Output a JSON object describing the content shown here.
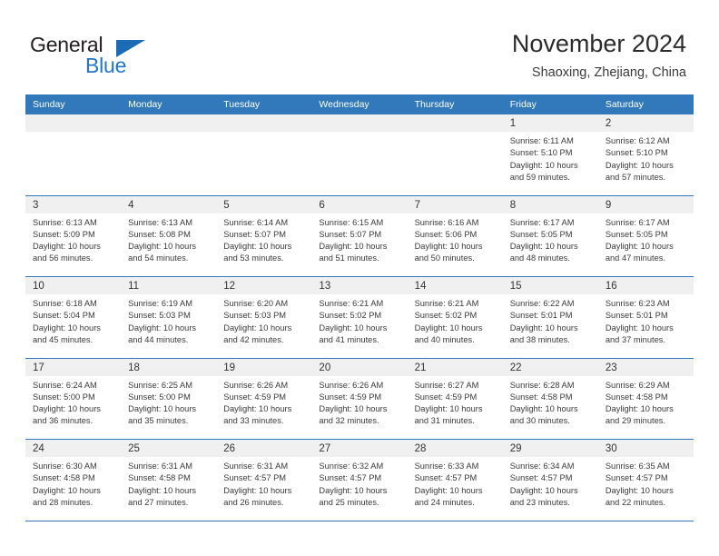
{
  "brand": {
    "name_dark": "General",
    "name_blue": "Blue",
    "accent_color": "#2176c7",
    "header_color": "#3179ba"
  },
  "header": {
    "title": "November 2024",
    "subtitle": "Shaoxing, Zhejiang, China"
  },
  "weekdays": [
    "Sunday",
    "Monday",
    "Tuesday",
    "Wednesday",
    "Thursday",
    "Friday",
    "Saturday"
  ],
  "weeks": [
    [
      {
        "empty": true,
        "day": "",
        "sunrise": "",
        "sunset": "",
        "daylight": ""
      },
      {
        "empty": true,
        "day": "",
        "sunrise": "",
        "sunset": "",
        "daylight": ""
      },
      {
        "empty": true,
        "day": "",
        "sunrise": "",
        "sunset": "",
        "daylight": ""
      },
      {
        "empty": true,
        "day": "",
        "sunrise": "",
        "sunset": "",
        "daylight": ""
      },
      {
        "empty": true,
        "day": "",
        "sunrise": "",
        "sunset": "",
        "daylight": ""
      },
      {
        "empty": false,
        "day": "1",
        "sunrise": "Sunrise: 6:11 AM",
        "sunset": "Sunset: 5:10 PM",
        "daylight": "Daylight: 10 hours and 59 minutes."
      },
      {
        "empty": false,
        "day": "2",
        "sunrise": "Sunrise: 6:12 AM",
        "sunset": "Sunset: 5:10 PM",
        "daylight": "Daylight: 10 hours and 57 minutes."
      }
    ],
    [
      {
        "empty": false,
        "day": "3",
        "sunrise": "Sunrise: 6:13 AM",
        "sunset": "Sunset: 5:09 PM",
        "daylight": "Daylight: 10 hours and 56 minutes."
      },
      {
        "empty": false,
        "day": "4",
        "sunrise": "Sunrise: 6:13 AM",
        "sunset": "Sunset: 5:08 PM",
        "daylight": "Daylight: 10 hours and 54 minutes."
      },
      {
        "empty": false,
        "day": "5",
        "sunrise": "Sunrise: 6:14 AM",
        "sunset": "Sunset: 5:07 PM",
        "daylight": "Daylight: 10 hours and 53 minutes."
      },
      {
        "empty": false,
        "day": "6",
        "sunrise": "Sunrise: 6:15 AM",
        "sunset": "Sunset: 5:07 PM",
        "daylight": "Daylight: 10 hours and 51 minutes."
      },
      {
        "empty": false,
        "day": "7",
        "sunrise": "Sunrise: 6:16 AM",
        "sunset": "Sunset: 5:06 PM",
        "daylight": "Daylight: 10 hours and 50 minutes."
      },
      {
        "empty": false,
        "day": "8",
        "sunrise": "Sunrise: 6:17 AM",
        "sunset": "Sunset: 5:05 PM",
        "daylight": "Daylight: 10 hours and 48 minutes."
      },
      {
        "empty": false,
        "day": "9",
        "sunrise": "Sunrise: 6:17 AM",
        "sunset": "Sunset: 5:05 PM",
        "daylight": "Daylight: 10 hours and 47 minutes."
      }
    ],
    [
      {
        "empty": false,
        "day": "10",
        "sunrise": "Sunrise: 6:18 AM",
        "sunset": "Sunset: 5:04 PM",
        "daylight": "Daylight: 10 hours and 45 minutes."
      },
      {
        "empty": false,
        "day": "11",
        "sunrise": "Sunrise: 6:19 AM",
        "sunset": "Sunset: 5:03 PM",
        "daylight": "Daylight: 10 hours and 44 minutes."
      },
      {
        "empty": false,
        "day": "12",
        "sunrise": "Sunrise: 6:20 AM",
        "sunset": "Sunset: 5:03 PM",
        "daylight": "Daylight: 10 hours and 42 minutes."
      },
      {
        "empty": false,
        "day": "13",
        "sunrise": "Sunrise: 6:21 AM",
        "sunset": "Sunset: 5:02 PM",
        "daylight": "Daylight: 10 hours and 41 minutes."
      },
      {
        "empty": false,
        "day": "14",
        "sunrise": "Sunrise: 6:21 AM",
        "sunset": "Sunset: 5:02 PM",
        "daylight": "Daylight: 10 hours and 40 minutes."
      },
      {
        "empty": false,
        "day": "15",
        "sunrise": "Sunrise: 6:22 AM",
        "sunset": "Sunset: 5:01 PM",
        "daylight": "Daylight: 10 hours and 38 minutes."
      },
      {
        "empty": false,
        "day": "16",
        "sunrise": "Sunrise: 6:23 AM",
        "sunset": "Sunset: 5:01 PM",
        "daylight": "Daylight: 10 hours and 37 minutes."
      }
    ],
    [
      {
        "empty": false,
        "day": "17",
        "sunrise": "Sunrise: 6:24 AM",
        "sunset": "Sunset: 5:00 PM",
        "daylight": "Daylight: 10 hours and 36 minutes."
      },
      {
        "empty": false,
        "day": "18",
        "sunrise": "Sunrise: 6:25 AM",
        "sunset": "Sunset: 5:00 PM",
        "daylight": "Daylight: 10 hours and 35 minutes."
      },
      {
        "empty": false,
        "day": "19",
        "sunrise": "Sunrise: 6:26 AM",
        "sunset": "Sunset: 4:59 PM",
        "daylight": "Daylight: 10 hours and 33 minutes."
      },
      {
        "empty": false,
        "day": "20",
        "sunrise": "Sunrise: 6:26 AM",
        "sunset": "Sunset: 4:59 PM",
        "daylight": "Daylight: 10 hours and 32 minutes."
      },
      {
        "empty": false,
        "day": "21",
        "sunrise": "Sunrise: 6:27 AM",
        "sunset": "Sunset: 4:59 PM",
        "daylight": "Daylight: 10 hours and 31 minutes."
      },
      {
        "empty": false,
        "day": "22",
        "sunrise": "Sunrise: 6:28 AM",
        "sunset": "Sunset: 4:58 PM",
        "daylight": "Daylight: 10 hours and 30 minutes."
      },
      {
        "empty": false,
        "day": "23",
        "sunrise": "Sunrise: 6:29 AM",
        "sunset": "Sunset: 4:58 PM",
        "daylight": "Daylight: 10 hours and 29 minutes."
      }
    ],
    [
      {
        "empty": false,
        "day": "24",
        "sunrise": "Sunrise: 6:30 AM",
        "sunset": "Sunset: 4:58 PM",
        "daylight": "Daylight: 10 hours and 28 minutes."
      },
      {
        "empty": false,
        "day": "25",
        "sunrise": "Sunrise: 6:31 AM",
        "sunset": "Sunset: 4:58 PM",
        "daylight": "Daylight: 10 hours and 27 minutes."
      },
      {
        "empty": false,
        "day": "26",
        "sunrise": "Sunrise: 6:31 AM",
        "sunset": "Sunset: 4:57 PM",
        "daylight": "Daylight: 10 hours and 26 minutes."
      },
      {
        "empty": false,
        "day": "27",
        "sunrise": "Sunrise: 6:32 AM",
        "sunset": "Sunset: 4:57 PM",
        "daylight": "Daylight: 10 hours and 25 minutes."
      },
      {
        "empty": false,
        "day": "28",
        "sunrise": "Sunrise: 6:33 AM",
        "sunset": "Sunset: 4:57 PM",
        "daylight": "Daylight: 10 hours and 24 minutes."
      },
      {
        "empty": false,
        "day": "29",
        "sunrise": "Sunrise: 6:34 AM",
        "sunset": "Sunset: 4:57 PM",
        "daylight": "Daylight: 10 hours and 23 minutes."
      },
      {
        "empty": false,
        "day": "30",
        "sunrise": "Sunrise: 6:35 AM",
        "sunset": "Sunset: 4:57 PM",
        "daylight": "Daylight: 10 hours and 22 minutes."
      }
    ]
  ]
}
